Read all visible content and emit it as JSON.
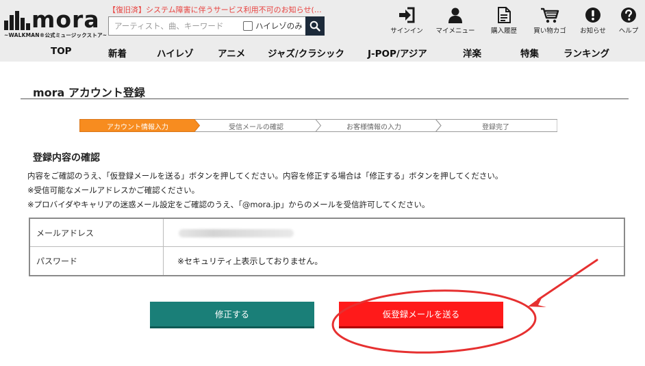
{
  "header": {
    "logo_text": "mora",
    "logo_tagline": "~WALKMAN®公式ミュージックストア~",
    "notice": "【復旧済】システム障害に伴うサービス利用不可のお知らせ(…",
    "search": {
      "placeholder": "アーティスト、曲、キーワード",
      "hires_label": "ハイレゾのみ"
    },
    "icons": [
      {
        "name": "signin-icon",
        "label": "サインイン"
      },
      {
        "name": "mymenu-icon",
        "label": "マイメニュー"
      },
      {
        "name": "history-icon",
        "label": "購入履歴"
      },
      {
        "name": "cart-icon",
        "label": "買い物カゴ"
      },
      {
        "name": "notice-icon",
        "label": "お知らせ"
      },
      {
        "name": "help-icon",
        "label": "ヘルプ"
      }
    ]
  },
  "nav": [
    "TOP",
    "新着",
    "ハイレゾ",
    "アニメ",
    "ジャズ/クラシック",
    "J-POP/アジア",
    "洋楽",
    "特集",
    "ランキング"
  ],
  "page": {
    "title": "mora アカウント登録",
    "steps": [
      "アカウント情報入力",
      "受信メールの確認",
      "お客様情報の入力",
      "登録完了"
    ],
    "section_title": "登録内容の確認",
    "descriptions": [
      "内容をご確認のうえ、「仮登録メールを送る」ボタンを押してください。内容を修正する場合は「修正する」ボタンを押してください。",
      "※受信可能なメールアドレスかご確認ください。",
      "※プロバイダやキャリアの迷惑メール設定をご確認のうえ、「@mora.jp」からのメールを受信許可してください。"
    ],
    "table": [
      {
        "label": "メールアドレス",
        "value": ""
      },
      {
        "label": "パスワード",
        "value": "※セキュリティ上表示しておりません。"
      }
    ],
    "buttons": {
      "edit": "修正する",
      "send": "仮登録メールを送る"
    }
  },
  "colors": {
    "header_bg": "#ececec",
    "step_active": "#f78c1f",
    "edit_button": "#1a7f78",
    "send_button": "#ff1a1a",
    "annotation": "#e63030"
  }
}
